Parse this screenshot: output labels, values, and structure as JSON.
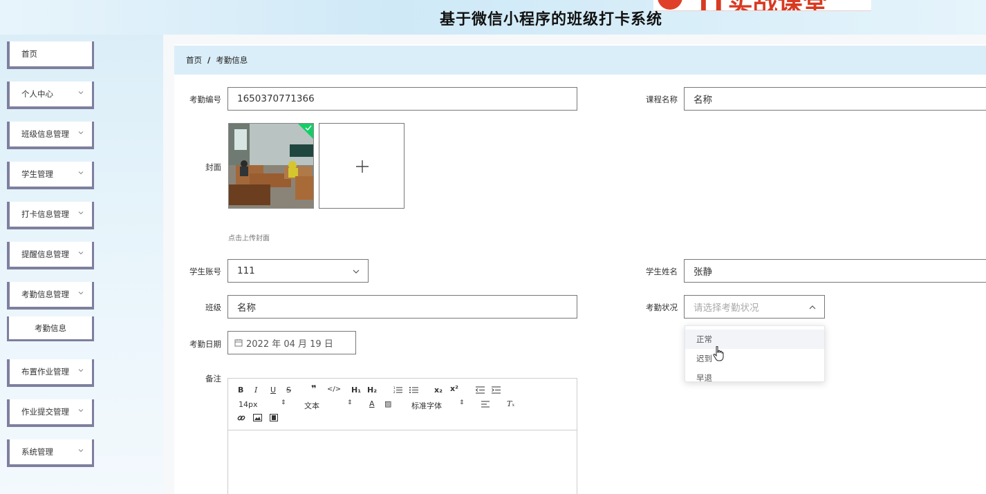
{
  "header": {
    "title": "基于微信小程序的班级打卡系统",
    "logo_text": "IT实战课堂"
  },
  "sidebar": {
    "items": [
      {
        "label": "首页"
      },
      {
        "label": "个人中心"
      },
      {
        "label": "班级信息管理"
      },
      {
        "label": "学生管理"
      },
      {
        "label": "打卡信息管理"
      },
      {
        "label": "提醒信息管理"
      },
      {
        "label": "考勤信息管理"
      },
      {
        "label": "考勤信息"
      },
      {
        "label": "布置作业管理"
      },
      {
        "label": "作业提交管理"
      },
      {
        "label": "系统管理"
      }
    ]
  },
  "breadcrumb": {
    "home": "首页",
    "separator": "/",
    "current": "考勤信息"
  },
  "form": {
    "attendance_no_label": "考勤编号",
    "attendance_no_value": "1650370771366",
    "course_name_label": "课程名称",
    "course_name_value": "名称",
    "cover_label": "封面",
    "cover_tip": "点击上传封面",
    "student_account_label": "学生账号",
    "student_account_value": "111",
    "student_name_label": "学生姓名",
    "student_name_value": "张静",
    "class_label": "班级",
    "class_value": "名称",
    "status_label": "考勤状况",
    "status_placeholder": "请选择考勤状况",
    "date_label": "考勤日期",
    "date_value": "2022 年 04 月 19 日",
    "remark_label": "备注"
  },
  "editor": {
    "font_size": "14px",
    "text_style": "文本",
    "font_family": "标准字体"
  },
  "status_options": [
    "正常",
    "迟到",
    "早退"
  ],
  "colors": {
    "accent_blue": "#daeef9",
    "menu_border": "#7e7f9e",
    "success_green": "#13ce66"
  }
}
